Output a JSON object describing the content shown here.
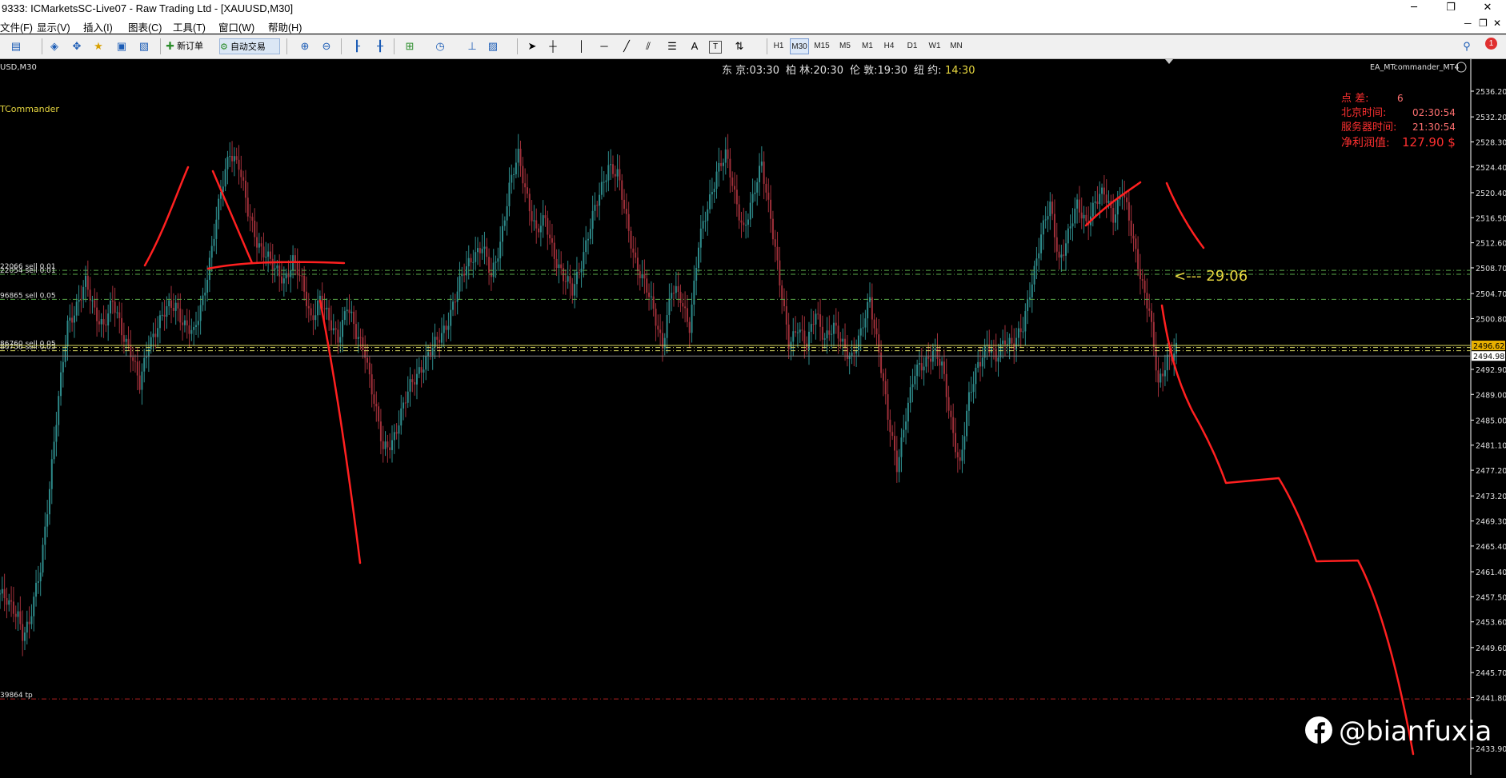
{
  "window": {
    "title": "9333: ICMarketsSC-Live07 - Raw Trading Ltd - [XAUUSD,M30]",
    "controls": {
      "minimize": "─",
      "restore": "❐",
      "close": "✕"
    }
  },
  "menu": {
    "items": [
      "文件(F)",
      "显示(V)",
      "插入(I)",
      "图表(C)",
      "工具(T)",
      "窗口(W)",
      "帮助(H)"
    ],
    "right_icons": {
      "minimize": "─",
      "restore": "❐",
      "close": "✕"
    }
  },
  "toolbar": {
    "new_order": "新订单",
    "auto_trading": "自动交易",
    "timeframes": [
      "H1",
      "M30",
      "M15",
      "M5",
      "M1",
      "H4",
      "D1",
      "W1",
      "MN"
    ],
    "selected_timeframe": "M30",
    "notification_count": "1",
    "text_tool": "A",
    "text_label_tool": "T"
  },
  "chart": {
    "symbol_label": "USD,M30",
    "ea_label": "EA_MTcommander_MT4",
    "ea_indicator_label": "TCommander",
    "clocks": {
      "tokyo": "东 京:03:30",
      "berlin": "柏 林:20:30",
      "london": "伦 敦:19:30",
      "newyork_label": "纽 约:",
      "newyork_time": "14:30"
    },
    "info_panel": {
      "spread_label": "点 差:",
      "spread_value": "6",
      "beijing_label": "北京时间:",
      "beijing_value": "02:30:54",
      "server_label": "服务器时间:",
      "server_value": "21:30:54",
      "profit_label": "净利润值:",
      "profit_value": "127.90 $"
    },
    "order_labels": [
      "22066 sell 0.01",
      "22054 sell 0.01",
      "96865 sell 0.05",
      "86760 sell 0.05",
      "86756 sell 0.05",
      "39864 tp"
    ],
    "arrow_annotation": "<--- 29:06",
    "price_tags": {
      "bid": "2496.62",
      "ask": "2494.98"
    },
    "y_axis": [
      "2536.20",
      "2532.20",
      "2528.30",
      "2524.40",
      "2520.40",
      "2516.50",
      "2512.60",
      "2508.70",
      "2504.70",
      "2500.80",
      "2496.62",
      "2494.98",
      "2492.90",
      "2489.00",
      "2485.00",
      "2481.10",
      "2477.20",
      "2473.20",
      "2469.30",
      "2465.40",
      "2461.40",
      "2457.50",
      "2453.60",
      "2449.60",
      "2445.70",
      "2441.80",
      "2433.90"
    ],
    "watermark": "@bianfuxia",
    "colors": {
      "background": "#000000",
      "bull": "#2e8b8b",
      "bear": "#a0303a",
      "drawing": "#ff2020",
      "level_line": "#5aa84a",
      "bid_line": "#d8d860",
      "tp_line": "#b02020",
      "info_text": "#ff3030",
      "info_value": "#ff7070"
    }
  },
  "chart_data": {
    "type": "candlestick",
    "symbol": "XAUUSD",
    "timeframe": "M30",
    "ylim": [
      2433.9,
      2536.2
    ],
    "levels": [
      {
        "label": "22066 sell 0.01",
        "price": 2508.3
      },
      {
        "label": "22054 sell 0.01",
        "price": 2507.7
      },
      {
        "label": "96865 sell 0.05",
        "price": 2503.8
      },
      {
        "label": "86760 sell 0.05",
        "price": 2496.3
      },
      {
        "label": "86756 sell 0.05",
        "price": 2495.8
      },
      {
        "label": "39864 tp",
        "price": 2441.6
      }
    ],
    "close_path": [
      [
        0,
        2458
      ],
      [
        4,
        2456
      ],
      [
        8,
        2455
      ],
      [
        10,
        2452
      ],
      [
        13,
        2453
      ],
      [
        18,
        2462
      ],
      [
        22,
        2475
      ],
      [
        26,
        2488
      ],
      [
        30,
        2500
      ],
      [
        34,
        2503
      ],
      [
        38,
        2506
      ],
      [
        42,
        2502
      ],
      [
        46,
        2500
      ],
      [
        50,
        2503
      ],
      [
        54,
        2499
      ],
      [
        58,
        2496
      ],
      [
        62,
        2490
      ],
      [
        66,
        2497
      ],
      [
        70,
        2500
      ],
      [
        74,
        2502
      ],
      [
        78,
        2503
      ],
      [
        82,
        2500
      ],
      [
        86,
        2498
      ],
      [
        90,
        2504
      ],
      [
        94,
        2512
      ],
      [
        98,
        2520
      ],
      [
        102,
        2527
      ],
      [
        106,
        2525
      ],
      [
        110,
        2517
      ],
      [
        114,
        2513
      ],
      [
        118,
        2511
      ],
      [
        122,
        2508
      ],
      [
        126,
        2507
      ],
      [
        130,
        2510
      ],
      [
        134,
        2506
      ],
      [
        138,
        2501
      ],
      [
        142,
        2504
      ],
      [
        146,
        2500
      ],
      [
        150,
        2498
      ],
      [
        154,
        2503
      ],
      [
        158,
        2498
      ],
      [
        162,
        2496
      ],
      [
        166,
        2488
      ],
      [
        170,
        2480
      ],
      [
        174,
        2482
      ],
      [
        178,
        2486
      ],
      [
        182,
        2490
      ],
      [
        186,
        2493
      ],
      [
        190,
        2495
      ],
      [
        194,
        2497
      ],
      [
        198,
        2500
      ],
      [
        202,
        2504
      ],
      [
        206,
        2508
      ],
      [
        210,
        2511
      ],
      [
        214,
        2512
      ],
      [
        218,
        2507
      ],
      [
        222,
        2513
      ],
      [
        226,
        2521
      ],
      [
        230,
        2526
      ],
      [
        234,
        2520
      ],
      [
        238,
        2514
      ],
      [
        242,
        2516
      ],
      [
        246,
        2511
      ],
      [
        250,
        2507
      ],
      [
        254,
        2505
      ],
      [
        258,
        2510
      ],
      [
        262,
        2515
      ],
      [
        266,
        2520
      ],
      [
        270,
        2525
      ],
      [
        274,
        2523
      ],
      [
        278,
        2516
      ],
      [
        282,
        2510
      ],
      [
        286,
        2506
      ],
      [
        290,
        2502
      ],
      [
        294,
        2497
      ],
      [
        298,
        2505
      ],
      [
        302,
        2504
      ],
      [
        306,
        2500
      ],
      [
        310,
        2512
      ],
      [
        314,
        2518
      ],
      [
        318,
        2524
      ],
      [
        322,
        2526
      ],
      [
        326,
        2520
      ],
      [
        330,
        2515
      ],
      [
        334,
        2519
      ],
      [
        338,
        2525
      ],
      [
        342,
        2517
      ],
      [
        346,
        2506
      ],
      [
        350,
        2497
      ],
      [
        354,
        2500
      ],
      [
        358,
        2496
      ],
      [
        362,
        2502
      ],
      [
        366,
        2498
      ],
      [
        370,
        2499
      ],
      [
        374,
        2497
      ],
      [
        378,
        2495
      ],
      [
        382,
        2498
      ],
      [
        386,
        2504
      ],
      [
        390,
        2496
      ],
      [
        394,
        2485
      ],
      [
        398,
        2478
      ],
      [
        402,
        2486
      ],
      [
        406,
        2492
      ],
      [
        410,
        2494
      ],
      [
        414,
        2496
      ],
      [
        418,
        2493
      ],
      [
        422,
        2485
      ],
      [
        426,
        2478
      ],
      [
        430,
        2488
      ],
      [
        434,
        2494
      ],
      [
        438,
        2497
      ],
      [
        442,
        2494
      ],
      [
        446,
        2498
      ],
      [
        450,
        2497
      ],
      [
        454,
        2499
      ],
      [
        458,
        2507
      ],
      [
        462,
        2514
      ],
      [
        466,
        2518
      ],
      [
        470,
        2510
      ],
      [
        474,
        2514
      ],
      [
        478,
        2518
      ],
      [
        482,
        2516
      ],
      [
        486,
        2519
      ],
      [
        490,
        2520
      ],
      [
        494,
        2517
      ],
      [
        498,
        2521
      ],
      [
        502,
        2514
      ],
      [
        506,
        2508
      ],
      [
        510,
        2502
      ],
      [
        514,
        2490
      ],
      [
        518,
        2495
      ],
      [
        522,
        2496
      ]
    ]
  }
}
